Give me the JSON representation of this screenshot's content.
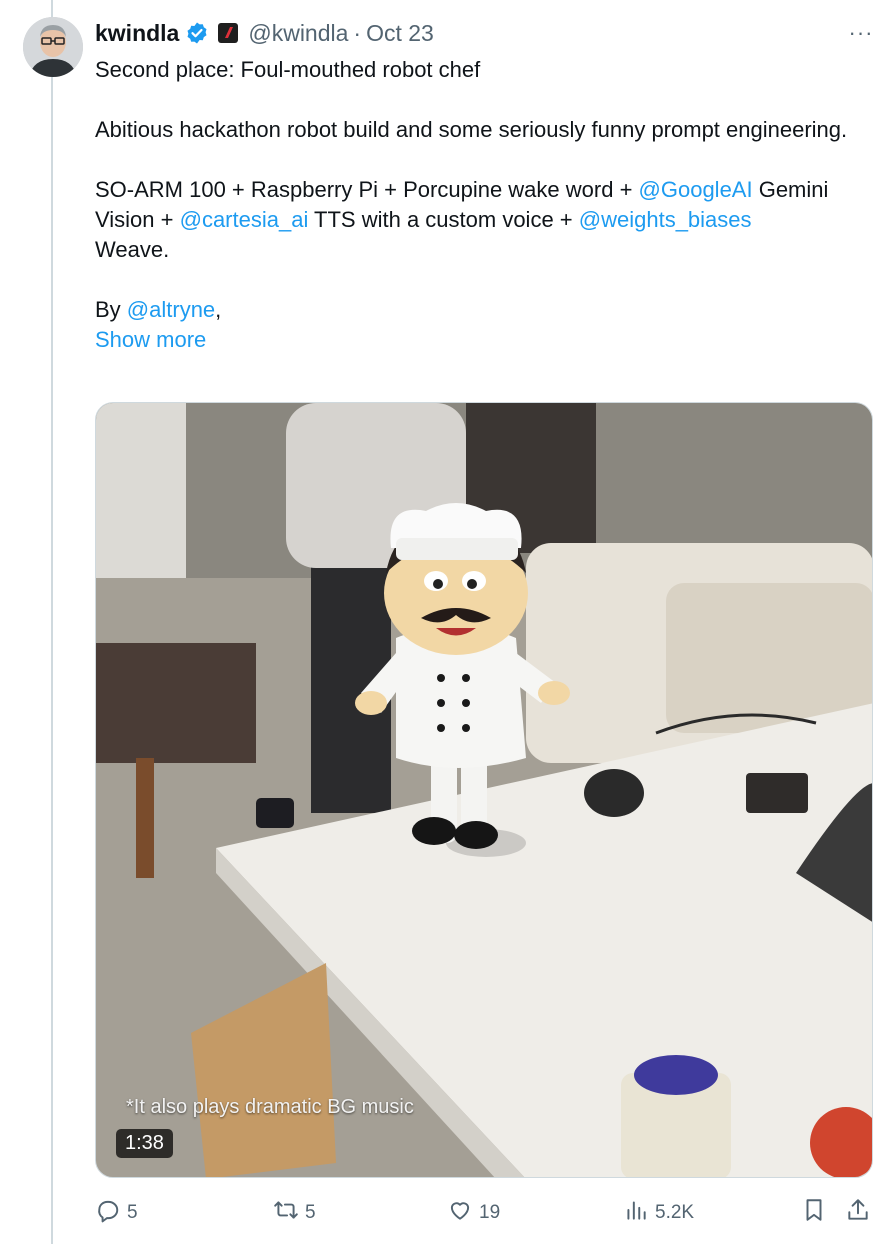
{
  "tweet": {
    "author_name": "kwindla",
    "handle": "@kwindla",
    "separator": "·",
    "date": "Oct 23",
    "more_label": "···",
    "line1": "Second place: Foul-mouthed robot chef",
    "line2": "Abitious hackathon robot build and some seriously funny prompt engineering.",
    "line3_a": "SO-ARM 100 + Raspberry Pi + Porcupine wake word + ",
    "mention_google": "@GoogleAI",
    "line3_b": " Gemini Vision + ",
    "mention_cartesia": "@cartesia_ai",
    "line3_c": " TTS with a custom voice + ",
    "mention_wandb": "@weights_biases",
    "line3_d": " Weave.",
    "by_prefix": "By ",
    "mention_altryne": "@altryne",
    "by_suffix": ",",
    "show_more": "Show more"
  },
  "media": {
    "caption": "*It also plays dramatic BG music",
    "duration": "1:38"
  },
  "actions": {
    "replies": "5",
    "reposts": "5",
    "likes": "19",
    "views": "5.2K"
  },
  "colors": {
    "link": "#1d9bf0",
    "muted": "#536471",
    "text": "#0f1419",
    "verified": "#1d9bf0"
  },
  "icons": {
    "verified": "verified-badge-icon",
    "affiliate": "affiliate-badge-icon",
    "more": "more-icon",
    "reply": "reply-icon",
    "repost": "repost-icon",
    "like": "like-icon",
    "views": "views-icon",
    "bookmark": "bookmark-icon",
    "share": "share-icon"
  }
}
